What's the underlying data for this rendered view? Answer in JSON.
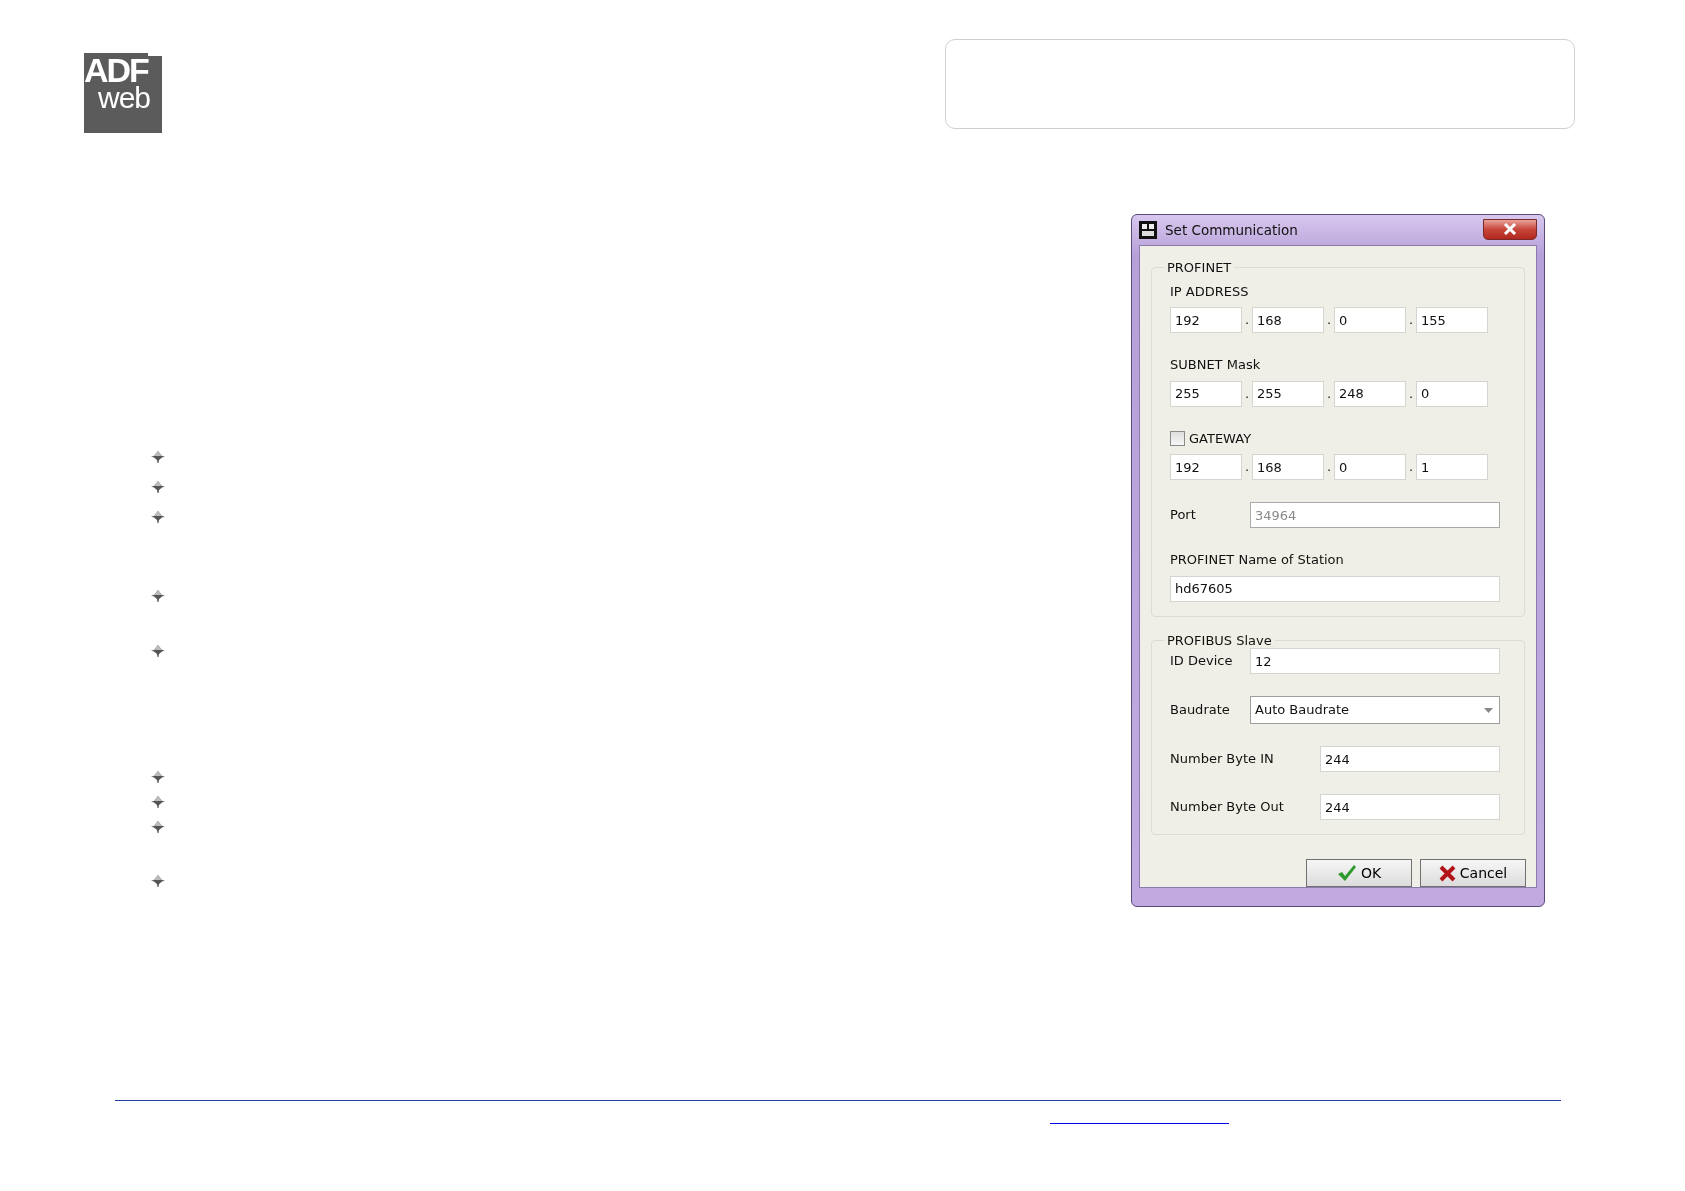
{
  "logo": {
    "top": "ADF",
    "bottom": "web"
  },
  "dialog": {
    "title": "Set Communication",
    "profinet": {
      "legend": "PROFINET",
      "ip_address": {
        "label": "IP ADDRESS",
        "octets": [
          "192",
          "168",
          "0",
          "155"
        ],
        "separator": "."
      },
      "subnet_mask": {
        "label": "SUBNET Mask",
        "octets": [
          "255",
          "255",
          "248",
          "0"
        ],
        "separator": "."
      },
      "gateway": {
        "label": "GATEWAY",
        "checked": false,
        "octets": [
          "192",
          "168",
          "0",
          "1"
        ],
        "separator": "."
      },
      "port": {
        "label": "Port",
        "value": "34964",
        "disabled": true
      },
      "station_name": {
        "label": "PROFINET Name of Station",
        "value": "hd67605"
      }
    },
    "profibus": {
      "legend": "PROFIBUS Slave",
      "fields": [
        {
          "kind": "text",
          "label": "ID Device",
          "value": "12"
        },
        {
          "kind": "dropdown",
          "label": "Baudrate",
          "value": "Auto Baudrate"
        },
        {
          "kind": "wide-label",
          "label": "Number Byte IN",
          "value": "244"
        },
        {
          "kind": "wide-label",
          "label": "Number Byte Out",
          "value": "244"
        }
      ]
    },
    "buttons": [
      {
        "kind": "ok",
        "label": "OK"
      },
      {
        "kind": "cancel",
        "label": "Cancel"
      }
    ]
  }
}
